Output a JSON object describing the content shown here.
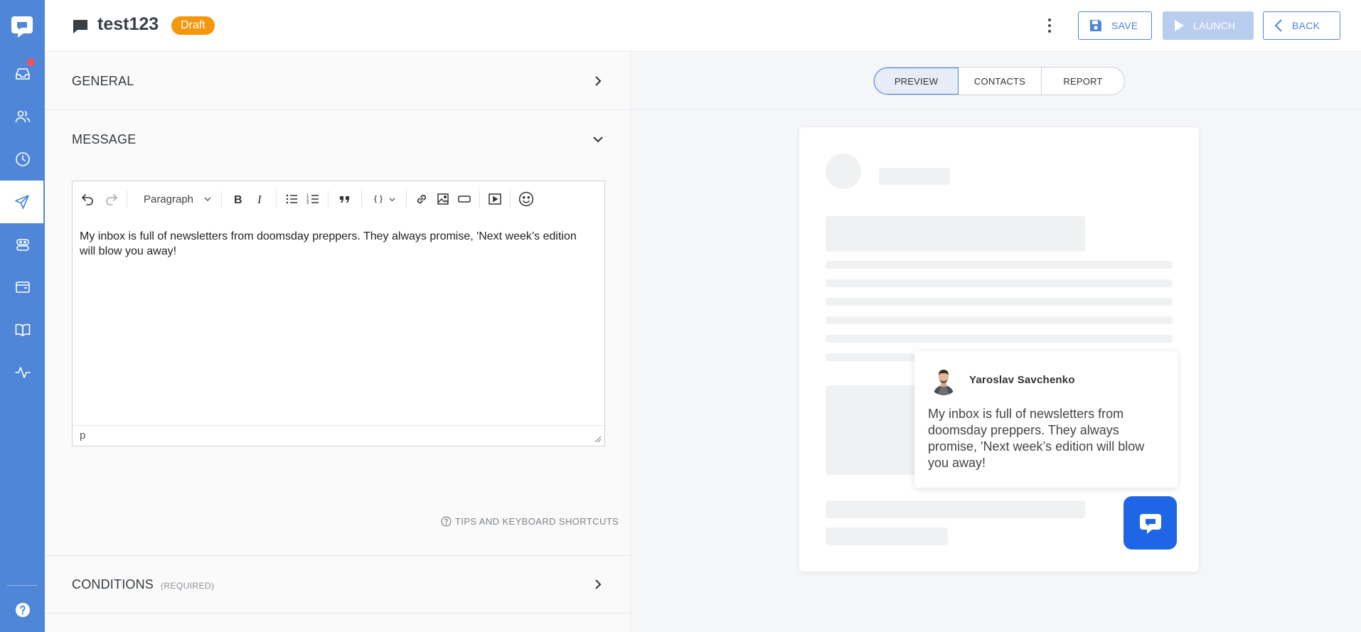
{
  "header": {
    "title": "test123",
    "badge": "Draft",
    "save_label": "SAVE",
    "launch_label": "LAUNCH",
    "back_label": "BACK"
  },
  "sidebar": {
    "items": [
      {
        "icon": "inbox-icon",
        "has_notification": true
      },
      {
        "icon": "contacts-icon"
      },
      {
        "icon": "history-icon"
      },
      {
        "icon": "send-icon",
        "active": true
      },
      {
        "icon": "bot-icon"
      },
      {
        "icon": "wallet-icon"
      },
      {
        "icon": "book-icon"
      },
      {
        "icon": "activity-icon"
      },
      {
        "icon": "help-icon"
      }
    ]
  },
  "sections": {
    "general": "GENERAL",
    "message": "MESSAGE",
    "conditions": "CONDITIONS",
    "conditions_required": "(REQUIRED)"
  },
  "editor": {
    "block_format": "Paragraph",
    "content": "My inbox is full of newsletters from doomsday preppers. They always promise, 'Next week’s edition will blow you away!",
    "status_path": "p",
    "tips_label": "TIPS AND KEYBOARD SHORTCUTS"
  },
  "preview": {
    "tabs": [
      "PREVIEW",
      "CONTACTS",
      "REPORT"
    ],
    "active_tab": "PREVIEW",
    "sender_name": "Yaroslav Savchenko",
    "message": "My inbox is full of newsletters from doomsday preppers. They always promise, 'Next week’s edition will blow you away!"
  },
  "colors": {
    "sidebar": "#4f86d8",
    "badge": "#f5960d",
    "accent": "#4f86d8",
    "launcher": "#1f66e6",
    "notification": "#f1505e"
  }
}
